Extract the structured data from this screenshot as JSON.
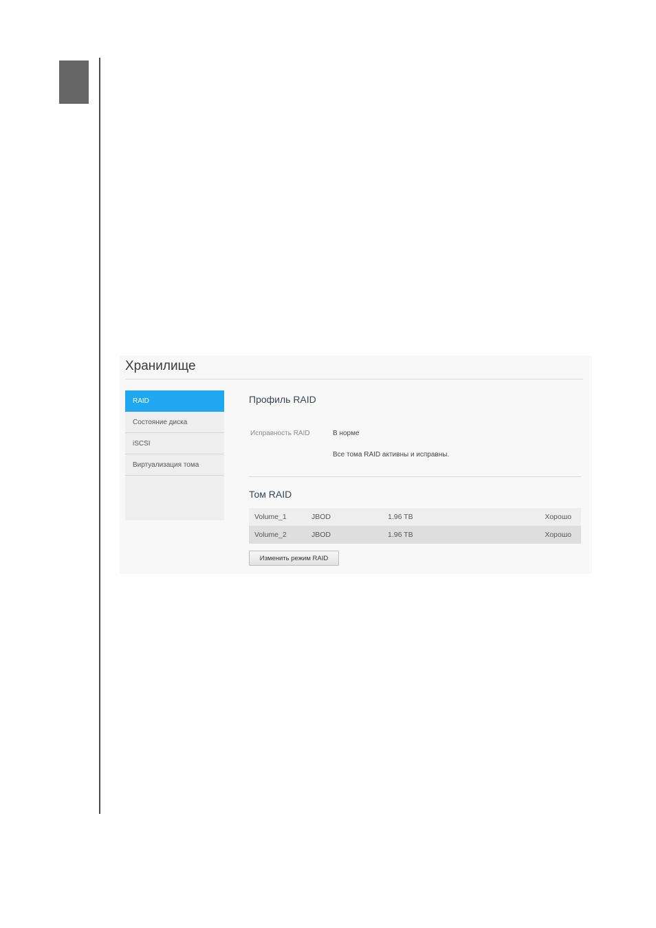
{
  "page": {
    "title": "Хранилище"
  },
  "sidebar": {
    "items": [
      {
        "label": "RAID",
        "active": true
      },
      {
        "label": "Состояние диска",
        "active": false
      },
      {
        "label": "iSCSI",
        "active": false
      },
      {
        "label": "Виртуализация тома",
        "active": false
      }
    ]
  },
  "raid_profile": {
    "title": "Профиль RAID",
    "health_label": "Исправность RAID",
    "health_value": "В норме",
    "health_detail": "Все тома RAID активны и исправны."
  },
  "raid_volumes": {
    "title": "Том RAID",
    "rows": [
      {
        "name": "Volume_1",
        "type": "JBOD",
        "size": "1.96 TB",
        "status": "Хорошо"
      },
      {
        "name": "Volume_2",
        "type": "JBOD",
        "size": "1.96 TB",
        "status": "Хорошо"
      }
    ],
    "change_button": "Изменить режим RAID"
  },
  "colors": {
    "accent": "#1fa8f0",
    "chapter_tab": "#666666"
  }
}
